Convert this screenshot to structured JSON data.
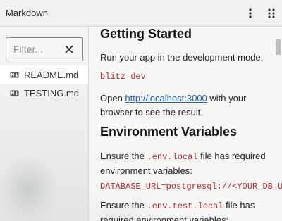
{
  "window": {
    "title": "Markdown"
  },
  "titlebar": {
    "menu_icon": "kebab-menu-icon",
    "grip_icon": "drag-grip-icon"
  },
  "sidebar": {
    "filter": {
      "placeholder": "Filter...",
      "value": ""
    },
    "files": [
      {
        "name": "README.md",
        "icon": "markdown-file-icon",
        "selected": true
      },
      {
        "name": "TESTING.md",
        "icon": "markdown-file-icon",
        "selected": false
      }
    ]
  },
  "content": {
    "getting_started": {
      "heading": "Getting Started",
      "intro": "Run your app in the development mode.",
      "command": "blitz dev",
      "open_prefix": "Open ",
      "open_link": "http://localhost:3000",
      "open_suffix": " with your browser to see the result."
    },
    "env_vars": {
      "heading": "Environment Variables",
      "p1_prefix": "Ensure the ",
      "p1_code": ".env.local",
      "p1_suffix": " file has required environment variables:",
      "codeblock": "DATABASE_URL=postgresql://<YOUR_DB_USE",
      "p2_prefix": "Ensure the ",
      "p2_code": ".env.test.local",
      "p2_suffix": " file has required environment variables:"
    }
  },
  "colors": {
    "code": "#b0262b",
    "link": "#1a5fb4",
    "selected_bg": "#ffffff"
  }
}
